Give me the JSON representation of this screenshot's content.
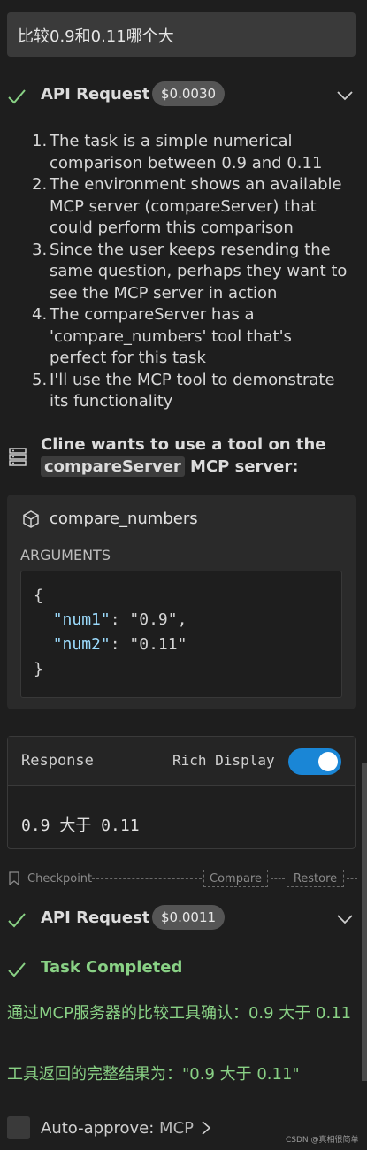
{
  "user_message": "比较0.9和0.11哪个大",
  "api_request_1": {
    "title": "API Request",
    "cost": "$0.0030"
  },
  "reasoning": [
    {
      "num": "1.",
      "text": "The task is a simple numerical comparison between 0.9 and 0.11"
    },
    {
      "num": "2.",
      "text": "The environment shows an available MCP server (compareServer) that could perform this comparison"
    },
    {
      "num": "3.",
      "text": "Since the user keeps resending the same question, perhaps they want to see the MCP server in action"
    },
    {
      "num": "4.",
      "text": "The compareServer has a 'compare_numbers' tool that's perfect for this task"
    },
    {
      "num": "5.",
      "text": "I'll use the MCP tool to demonstrate its functionality"
    }
  ],
  "tool_request": {
    "prefix": "Cline wants to use a tool on the ",
    "server": "compareServer",
    "suffix": " MCP server:"
  },
  "tool_card": {
    "tool_name": "compare_numbers",
    "arguments_label": "ARGUMENTS",
    "code": {
      "open": "{",
      "key1": "\"num1\"",
      "val1": ": \"0.9\",",
      "key2": "\"num2\"",
      "val2": ": \"0.11\"",
      "close": "}"
    }
  },
  "response": {
    "label": "Response",
    "rich_display_label": "Rich Display",
    "rich_display_on": true,
    "value": "0.9 大于 0.11"
  },
  "checkpoint": {
    "label": "Checkpoint",
    "compare_label": "Compare",
    "restore_label": "Restore"
  },
  "api_request_2": {
    "title": "API Request",
    "cost": "$0.0011"
  },
  "task": {
    "title": "Task Completed",
    "line1": "通过MCP服务器的比较工具确认：0.9 大于 0.11",
    "line2": "工具返回的完整结果为：\"0.9 大于 0.11\""
  },
  "auto_approve": {
    "label": "Auto-approve: ",
    "value": "MCP"
  },
  "watermark": "CSDN @真相很简单",
  "colors": {
    "background": "#1e1e1e",
    "success_green": "#89d185",
    "toggle_blue": "#1a86d6",
    "json_key": "#9cdcfe"
  }
}
